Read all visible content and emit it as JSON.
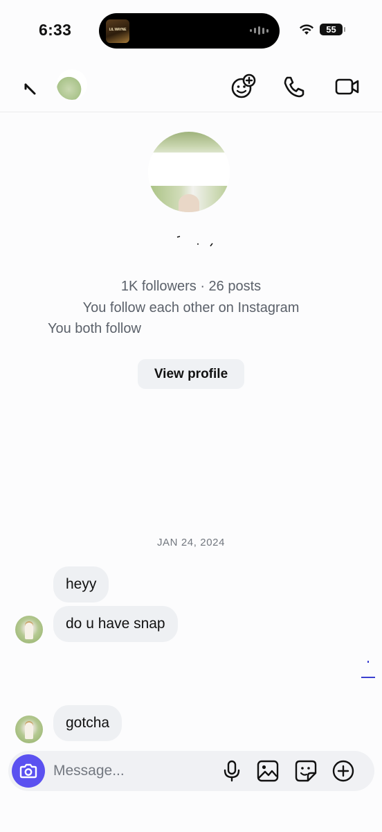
{
  "status_bar": {
    "time": "6:33",
    "island_art_text": "LIL WAYNE",
    "battery": "55"
  },
  "header": {
    "back_icon": "back-arrow-icon",
    "actions": [
      "add-effect-icon",
      "phone-icon",
      "video-icon"
    ]
  },
  "profile": {
    "stats": "1K followers · 26 posts",
    "mutual": "You follow each other on Instagram",
    "both_follow": "You both follow",
    "view_profile_label": "View profile"
  },
  "chat": {
    "date_separator": "JAN 24, 2024",
    "messages": [
      {
        "text": "heyy"
      },
      {
        "text": "do u have snap"
      },
      {
        "text": "gotcha"
      }
    ]
  },
  "composer": {
    "placeholder": "Message...",
    "icons": [
      "camera-icon",
      "microphone-icon",
      "gallery-icon",
      "sticker-icon",
      "add-icon"
    ]
  },
  "colors": {
    "accent": "#5b51f0",
    "bubble": "#eef0f3",
    "secondary_text": "#5b616a"
  }
}
